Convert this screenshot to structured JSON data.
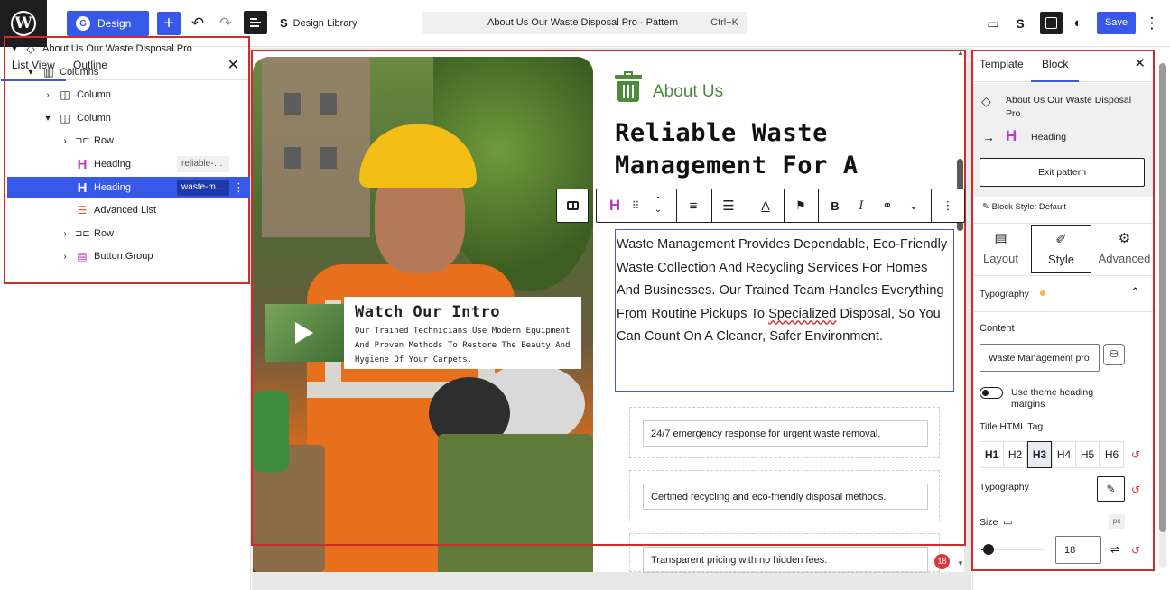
{
  "topbar": {
    "logo": "W",
    "design_label": "Design",
    "add_label": "+",
    "undo_icon": "↶",
    "redo_icon": "↷",
    "design_library_label": "Design Library",
    "command_title": "About Us Our Waste Disposal Pro · Pattern",
    "command_shortcut": "Ctrl+K",
    "save_label": "Save",
    "more_icon": "⋮"
  },
  "left_panel": {
    "tabs": [
      "List View",
      "Outline"
    ],
    "close": "✕",
    "tree": [
      {
        "label": "About Us Our Waste Disposal Pro",
        "icon": "pattern-icon",
        "glyph": "◇",
        "caret": "▾"
      },
      {
        "label": "Columns",
        "icon": "columns-icon",
        "glyph": "▥",
        "caret": "▾"
      },
      {
        "label": "Column",
        "icon": "column-icon",
        "glyph": "◫",
        "caret": "›"
      },
      {
        "label": "Column",
        "icon": "column-icon",
        "glyph": "◫",
        "caret": "▾"
      },
      {
        "label": "Row",
        "icon": "row-icon",
        "glyph": "⊐⊏",
        "caret": "›"
      },
      {
        "label": "Heading",
        "icon": "heading-icon",
        "glyph": "H",
        "chip": "reliable-…"
      },
      {
        "label": "Heading",
        "icon": "heading-icon",
        "glyph": "H",
        "chip": "waste-m…"
      },
      {
        "label": "Advanced List",
        "icon": "list-icon",
        "glyph": "☰"
      },
      {
        "label": "Row",
        "icon": "row-icon",
        "glyph": "⊐⊏",
        "caret": "›"
      },
      {
        "label": "Button Group",
        "icon": "button-group-icon",
        "glyph": "▤",
        "caret": "›"
      }
    ]
  },
  "canvas": {
    "intro_title": "Watch Our Intro",
    "intro_text": "Our Trained Technicians Use Modern Equipment And Proven Methods To Restore The Beauty And Hygiene Of Your Carpets.",
    "about_label": "About Us",
    "heading": "Reliable Waste Management For A",
    "paragraph_a": "Waste Management Provides Dependable, Eco-Friendly Waste Collection And Recycling Services For Homes And Businesses. Our Trained Team Handles Everything From Routine Pickups To ",
    "paragraph_spell": "Specialized",
    "paragraph_b": " Disposal, So You Can Count On A Cleaner, Safer Environment.",
    "features": [
      "24/7 emergency response for urgent waste removal.",
      "Certified recycling and eco-friendly disposal methods.",
      "Transparent pricing with no hidden fees."
    ],
    "notification_count": "18",
    "accent_color": "#4c8b3b"
  },
  "block_toolbar": {
    "heading_glyph": "H",
    "bold": "B",
    "italic": "I",
    "link": "⚭",
    "more_rich": "⌄",
    "options": "⋮"
  },
  "right_panel": {
    "tabs": [
      "Template",
      "Block"
    ],
    "close": "✕",
    "pattern_name": "About Us Our Waste Disposal Pro",
    "arrow": "→",
    "block_name": "Heading",
    "exit_label": "Exit pattern",
    "block_style": "Block Style: Default",
    "segments": [
      "Layout",
      "Style",
      "Advanced"
    ],
    "typography_section": "Typography",
    "content_label": "Content",
    "content_value": "Waste Management pro",
    "theme_margins_label": "Use theme heading margins",
    "title_tag_label": "Title HTML Tag",
    "tags": [
      "H1",
      "H2",
      "H3",
      "H4",
      "H5",
      "H6"
    ],
    "typography_label": "Typography",
    "size_label": "Size",
    "unit": "px",
    "size_value": "18",
    "slider_fraction": 0.12
  }
}
